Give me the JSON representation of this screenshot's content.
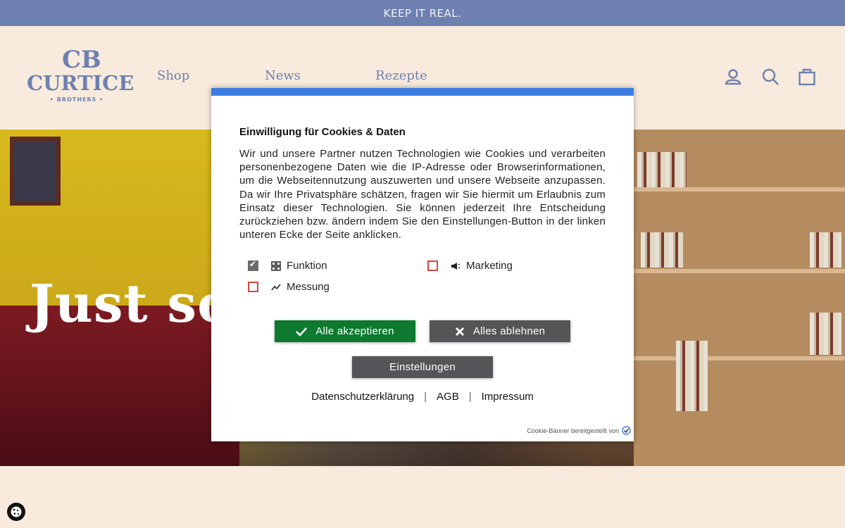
{
  "announcement": "KEEP IT REAL.",
  "logo": {
    "monogram": "CB",
    "word": "CURTICE",
    "sub": "• BROTHERS •"
  },
  "nav": {
    "shop": "Shop",
    "news": "News",
    "rezepte": "Rezepte"
  },
  "hero": {
    "title": "Just so"
  },
  "cookie_modal": {
    "title": "Einwilligung für Cookies & Daten",
    "text": "Wir und unsere Partner nutzen Technologien wie Cookies und verarbeiten personenbezogene Daten wie die IP-Adresse oder Browserinformationen, um die Webseitennutzung auszuwerten und unsere Webseite anzupassen. Da wir Ihre Privatsphäre schätzen, fragen wir Sie hiermit um Erlaubnis zum Einsatz dieser Technologien. Sie können jederzeit Ihre Entscheidung zurückziehen bzw. ändern indem Sie den Einstellungen-Button in der linken unteren Ecke der Seite anklicken.",
    "options": [
      {
        "label": "Funktion",
        "checked": true,
        "icon": "puzzle-icon"
      },
      {
        "label": "Marketing",
        "checked": false,
        "icon": "megaphone-icon"
      },
      {
        "label": "Messung",
        "checked": false,
        "icon": "chart-icon"
      }
    ],
    "accept_label": "Alle akzeptieren",
    "reject_label": "Alles ablehnen",
    "settings_label": "Einstellungen",
    "links": {
      "privacy": "Datenschutzerklärung",
      "agb": "AGB",
      "impressum": "Impressum",
      "separator": "|"
    },
    "credit": "Cookie-Banner bereitgestellt von"
  },
  "colors": {
    "brand": "#6e80b0",
    "background": "#f8ebdd",
    "accept": "#0d7a2f",
    "neutral_button": "#555558",
    "modal_accent": "#3d7ee2"
  }
}
